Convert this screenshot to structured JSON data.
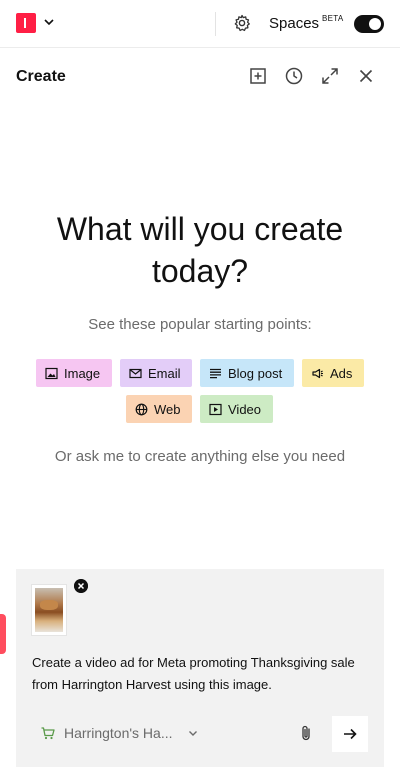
{
  "topbar": {
    "logo_icon": "brand-logo-icon",
    "spaces_label": "Spaces",
    "beta_badge": "BETA",
    "spaces_toggle_on": true
  },
  "panel": {
    "title": "Create",
    "icons": [
      "new-chat-icon",
      "history-icon",
      "expand-icon",
      "close-icon"
    ]
  },
  "hero": {
    "headline": "What will you create today?",
    "subtitle": "See these popular starting points:",
    "ask_text": "Or ask me to create anything else you need"
  },
  "chips": [
    {
      "label": "Image",
      "icon": "image-icon",
      "color": "#f6c6f2"
    },
    {
      "label": "Email",
      "icon": "mail-icon",
      "color": "#e3cdf8"
    },
    {
      "label": "Blog post",
      "icon": "text-lines-icon",
      "color": "#c6e6f9"
    },
    {
      "label": "Ads",
      "icon": "megaphone-icon",
      "color": "#fbeaa6"
    },
    {
      "label": "Web",
      "icon": "globe-icon",
      "color": "#fbd3b3"
    },
    {
      "label": "Video",
      "icon": "play-icon",
      "color": "#cdebc4"
    }
  ],
  "compose": {
    "prompt": "Create a video ad for Meta promoting Thanksgiving sale from Harrington Harvest using this image.",
    "brand_selector": "Harrington's Ha...",
    "attachment_icon": "paperclip-icon",
    "send_icon": "arrow-right-icon"
  },
  "colors": {
    "accent": "#ff1f45",
    "muted_text": "#6b6b6b",
    "compose_bg": "#f2f2f2"
  }
}
